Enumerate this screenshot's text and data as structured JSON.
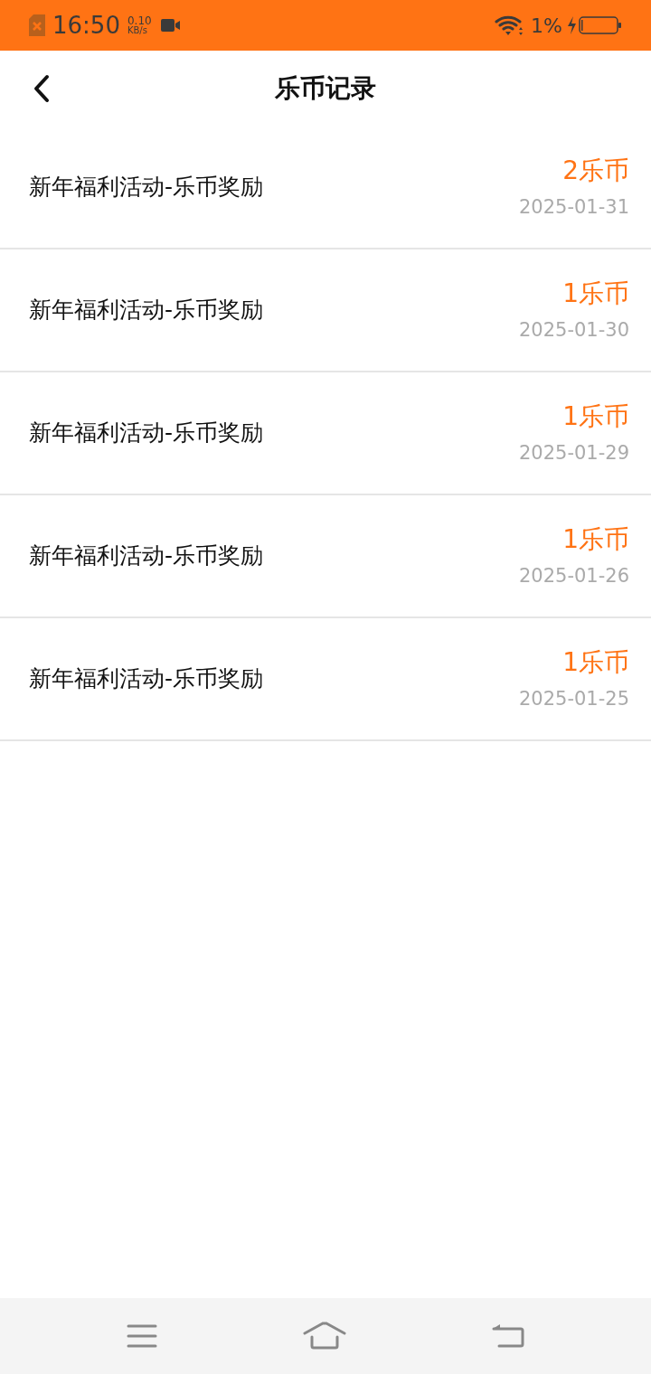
{
  "status_bar": {
    "time": "16:50",
    "speed_value": "0.10",
    "speed_unit": "KB/s",
    "battery": "1%"
  },
  "header": {
    "title": "乐币记录"
  },
  "records": [
    {
      "title": "新年福利活动-乐币奖励",
      "amount": "2乐币",
      "date": "2025-01-31"
    },
    {
      "title": "新年福利活动-乐币奖励",
      "amount": "1乐币",
      "date": "2025-01-30"
    },
    {
      "title": "新年福利活动-乐币奖励",
      "amount": "1乐币",
      "date": "2025-01-29"
    },
    {
      "title": "新年福利活动-乐币奖励",
      "amount": "1乐币",
      "date": "2025-01-26"
    },
    {
      "title": "新年福利活动-乐币奖励",
      "amount": "1乐币",
      "date": "2025-01-25"
    }
  ]
}
